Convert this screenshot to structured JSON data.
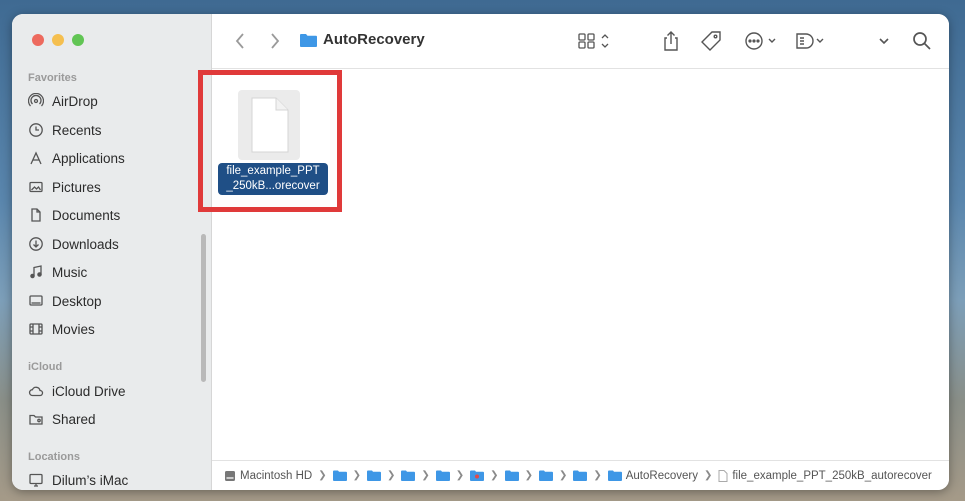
{
  "window": {
    "title": "AutoRecovery"
  },
  "sidebar": {
    "sections": [
      {
        "title": "Favorites",
        "items": [
          {
            "label": "AirDrop",
            "icon": "airdrop-icon"
          },
          {
            "label": "Recents",
            "icon": "clock-icon"
          },
          {
            "label": "Applications",
            "icon": "applications-icon"
          },
          {
            "label": "Pictures",
            "icon": "photo-icon"
          },
          {
            "label": "Documents",
            "icon": "document-icon"
          },
          {
            "label": "Downloads",
            "icon": "download-icon"
          },
          {
            "label": "Music",
            "icon": "music-icon"
          },
          {
            "label": "Desktop",
            "icon": "desktop-icon"
          },
          {
            "label": "Movies",
            "icon": "film-icon"
          }
        ]
      },
      {
        "title": "iCloud",
        "items": [
          {
            "label": "iCloud Drive",
            "icon": "cloud-icon"
          },
          {
            "label": "Shared",
            "icon": "shared-folder-icon"
          }
        ]
      },
      {
        "title": "Locations",
        "items": [
          {
            "label": "Dilum’s iMac",
            "icon": "imac-icon"
          }
        ]
      }
    ]
  },
  "toolbar": {
    "icons": [
      "back-icon",
      "forward-icon",
      "grid-view-icon",
      "share-icon",
      "tag-icon",
      "more-icon",
      "preview-icon",
      "chevron-down-icon",
      "search-icon"
    ]
  },
  "content": {
    "files": [
      {
        "label_line1": "file_example_PPT",
        "label_line2": "_250kB...orecover",
        "selected": true
      }
    ]
  },
  "pathbar": {
    "root": "Macintosh HD",
    "folder": "AutoRecovery",
    "file": "file_example_PPT_250kB_autorecover"
  },
  "colors": {
    "selection": "#1f4f86",
    "highlight_box": "#e03a3a",
    "folder_blue": "#3e97e6"
  }
}
